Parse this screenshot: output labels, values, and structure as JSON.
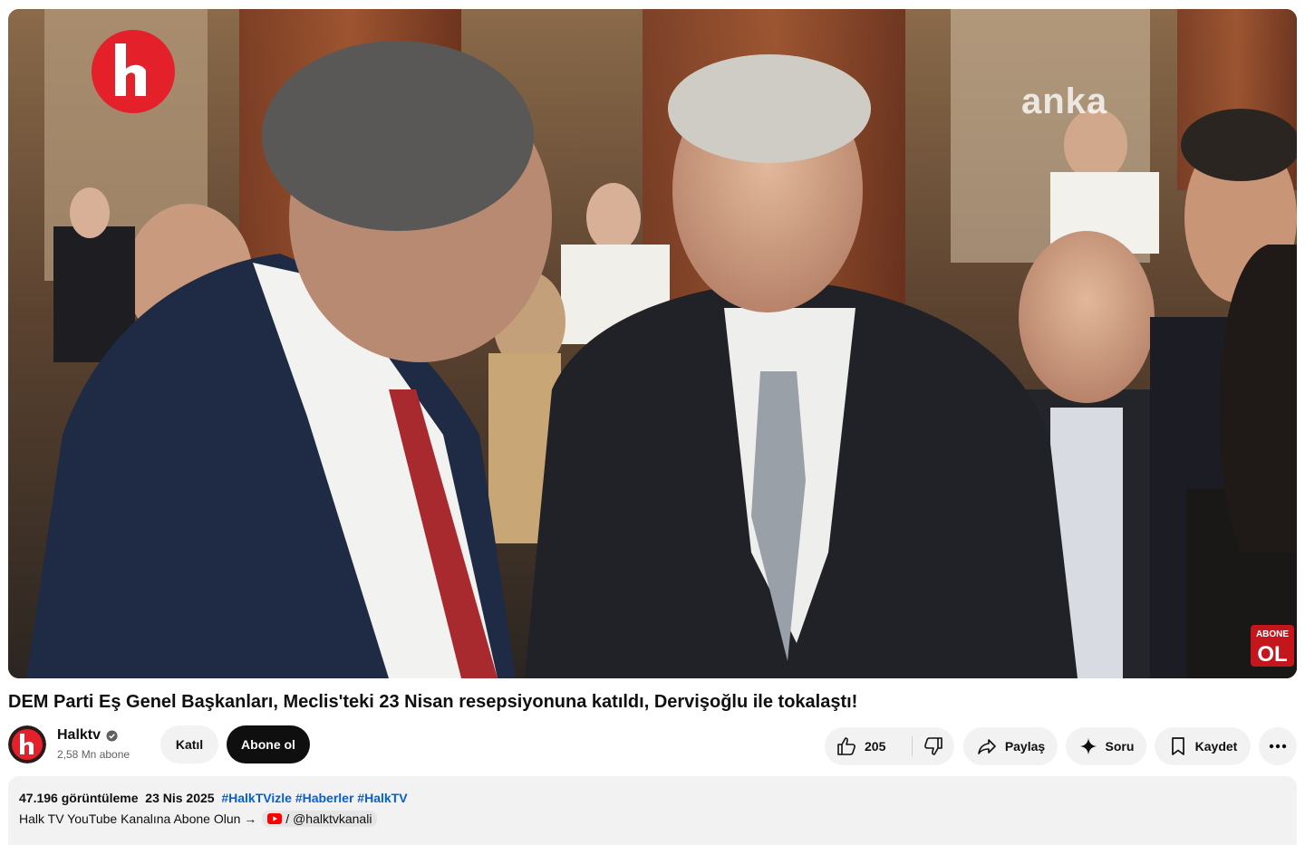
{
  "video": {
    "watermark_logo": "halk",
    "watermark_agency": "anka",
    "corner_badge_top": "ABONE",
    "corner_badge_bottom": "OL"
  },
  "title": "DEM Parti Eş Genel Başkanları, Meclis'teki 23 Nisan resepsiyonuna katıldı, Dervişoğlu ile tokalaştı!",
  "channel": {
    "name": "Halktv",
    "subscribers": "2,58 Mn abone",
    "avatar_text": "halk"
  },
  "buttons": {
    "join": "Katıl",
    "subscribe": "Abone ol",
    "like_count": "205",
    "share": "Paylaş",
    "ask": "Soru",
    "save": "Kaydet"
  },
  "description": {
    "views": "47.196 görüntüleme",
    "date": "23 Nis 2025",
    "tags": [
      "#HalkTVizle",
      "#Haberler",
      "#HalkTV"
    ],
    "text": "Halk TV YouTube Kanalına Abone Olun →",
    "link": "/ @halktvkanali"
  },
  "colors": {
    "brand_red": "#e4202a",
    "link_blue": "#065fd4",
    "subscribe_bg": "#0f0f0f",
    "chip_bg": "#f2f2f2"
  },
  "icons": [
    "verified-icon",
    "like-icon",
    "dislike-icon",
    "share-icon",
    "sparkle-icon",
    "bookmark-icon",
    "more-icon",
    "youtube-icon"
  ]
}
